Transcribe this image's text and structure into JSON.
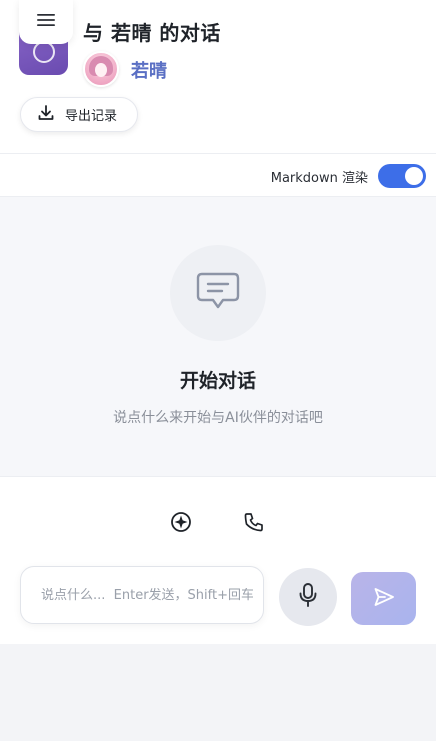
{
  "header": {
    "title": "与 若晴 的对话",
    "character_name": "若晴",
    "export_label": "导出记录"
  },
  "toolbar": {
    "markdown_label": "Markdown 渲染",
    "markdown_enabled": true
  },
  "empty_state": {
    "title": "开始对话",
    "subtitle": "说点什么来开始与AI伙伴的对话吧"
  },
  "composer": {
    "placeholder": "说点什么...  Enter发送，Shift+回车换行",
    "value": ""
  },
  "icons": {
    "menu": "menu-icon",
    "export": "download-icon",
    "empty": "chat-bubble-icon",
    "quick_1": "compass-icon",
    "quick_2": "phone-icon",
    "mic": "microphone-icon",
    "send": "send-icon"
  },
  "colors": {
    "accent": "#3d6ee8",
    "character_name": "#5a6fc4",
    "logo": "#7a58bd",
    "send_button": "#b0b4ec"
  }
}
